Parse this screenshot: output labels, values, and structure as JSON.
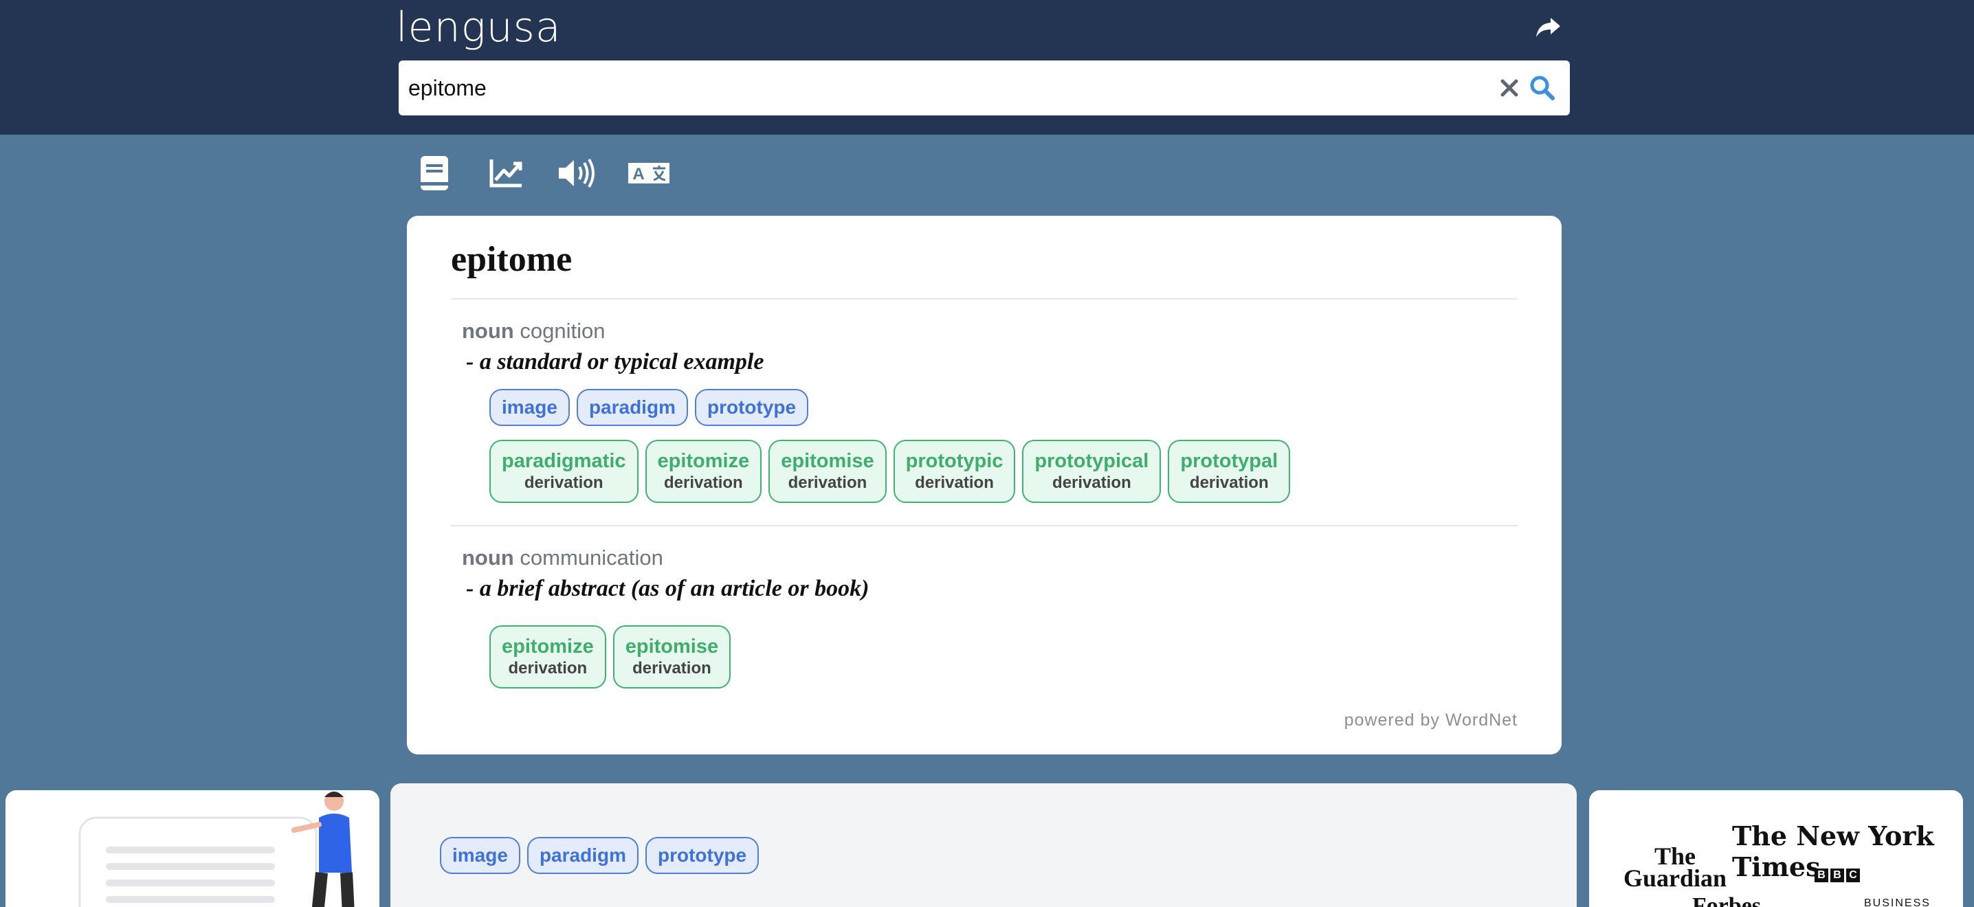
{
  "header": {
    "logo": "lengusa",
    "search_value": "epitome"
  },
  "toolbar": {
    "items": [
      {
        "icon": "book-icon"
      },
      {
        "icon": "trend-chart-icon"
      },
      {
        "icon": "speaker-icon"
      },
      {
        "icon": "translate-icon"
      }
    ]
  },
  "entry": {
    "word": "epitome",
    "senses": [
      {
        "pos": "noun",
        "category": "cognition",
        "gloss": "- a standard or typical example",
        "synonyms": [
          "image",
          "paradigm",
          "prototype"
        ],
        "derivations": [
          {
            "word": "paradigmatic",
            "type": "derivation"
          },
          {
            "word": "epitomize",
            "type": "derivation"
          },
          {
            "word": "epitomise",
            "type": "derivation"
          },
          {
            "word": "prototypic",
            "type": "derivation"
          },
          {
            "word": "prototypical",
            "type": "derivation"
          },
          {
            "word": "prototypal",
            "type": "derivation"
          }
        ]
      },
      {
        "pos": "noun",
        "category": "communication",
        "gloss": "- a brief abstract (as of an article or book)",
        "synonyms": [],
        "derivations": [
          {
            "word": "epitomize",
            "type": "derivation"
          },
          {
            "word": "epitomise",
            "type": "derivation"
          }
        ]
      }
    ],
    "powered_by": "powered by WordNet"
  },
  "bottom": {
    "synonyms": [
      "image",
      "paradigm",
      "prototype"
    ],
    "press_logos": {
      "nyt": "The New York Times",
      "guardian_line1": "The",
      "guardian_line2": "Guardian",
      "bbc": [
        "B",
        "B",
        "C"
      ],
      "forbes": "Forbes",
      "business": "BUSINESS"
    }
  },
  "colors": {
    "header_bg": "#243453",
    "page_bg": "#527899",
    "chip_blue": "#3f72d6",
    "chip_green": "#3fae6c"
  }
}
